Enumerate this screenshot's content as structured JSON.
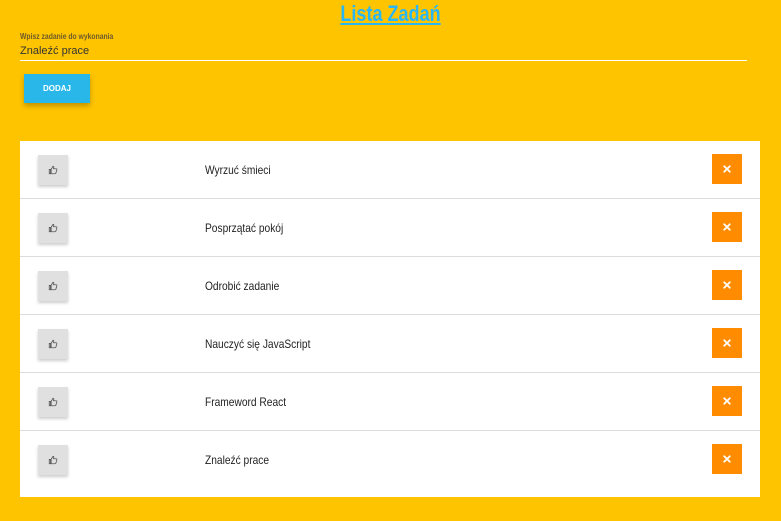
{
  "header": {
    "title": "Lista Zadań"
  },
  "form": {
    "input_label": "Wpisz zadanie do wykonania",
    "input_value": "Znaleźć prace",
    "add_label": "DODAJ"
  },
  "colors": {
    "background": "#FFC400",
    "title": "#29B6F6",
    "add_button": "#29B6E8",
    "delete_button": "#FF8C00"
  },
  "tasks": [
    {
      "label": "Wyrzuć śmieci",
      "like_icon": "thumbs-up-icon",
      "delete_icon": "close-icon"
    },
    {
      "label": "Posprzątać pokój",
      "like_icon": "thumbs-up-icon",
      "delete_icon": "close-icon"
    },
    {
      "label": "Odrobić zadanie",
      "like_icon": "thumbs-up-icon",
      "delete_icon": "close-icon"
    },
    {
      "label": "Nauczyć się JavaScript",
      "like_icon": "thumbs-up-icon",
      "delete_icon": "close-icon"
    },
    {
      "label": "Frameword React",
      "like_icon": "thumbs-up-icon",
      "delete_icon": "close-icon"
    },
    {
      "label": "Znaleźć prace",
      "like_icon": "thumbs-up-icon",
      "delete_icon": "close-icon"
    }
  ]
}
